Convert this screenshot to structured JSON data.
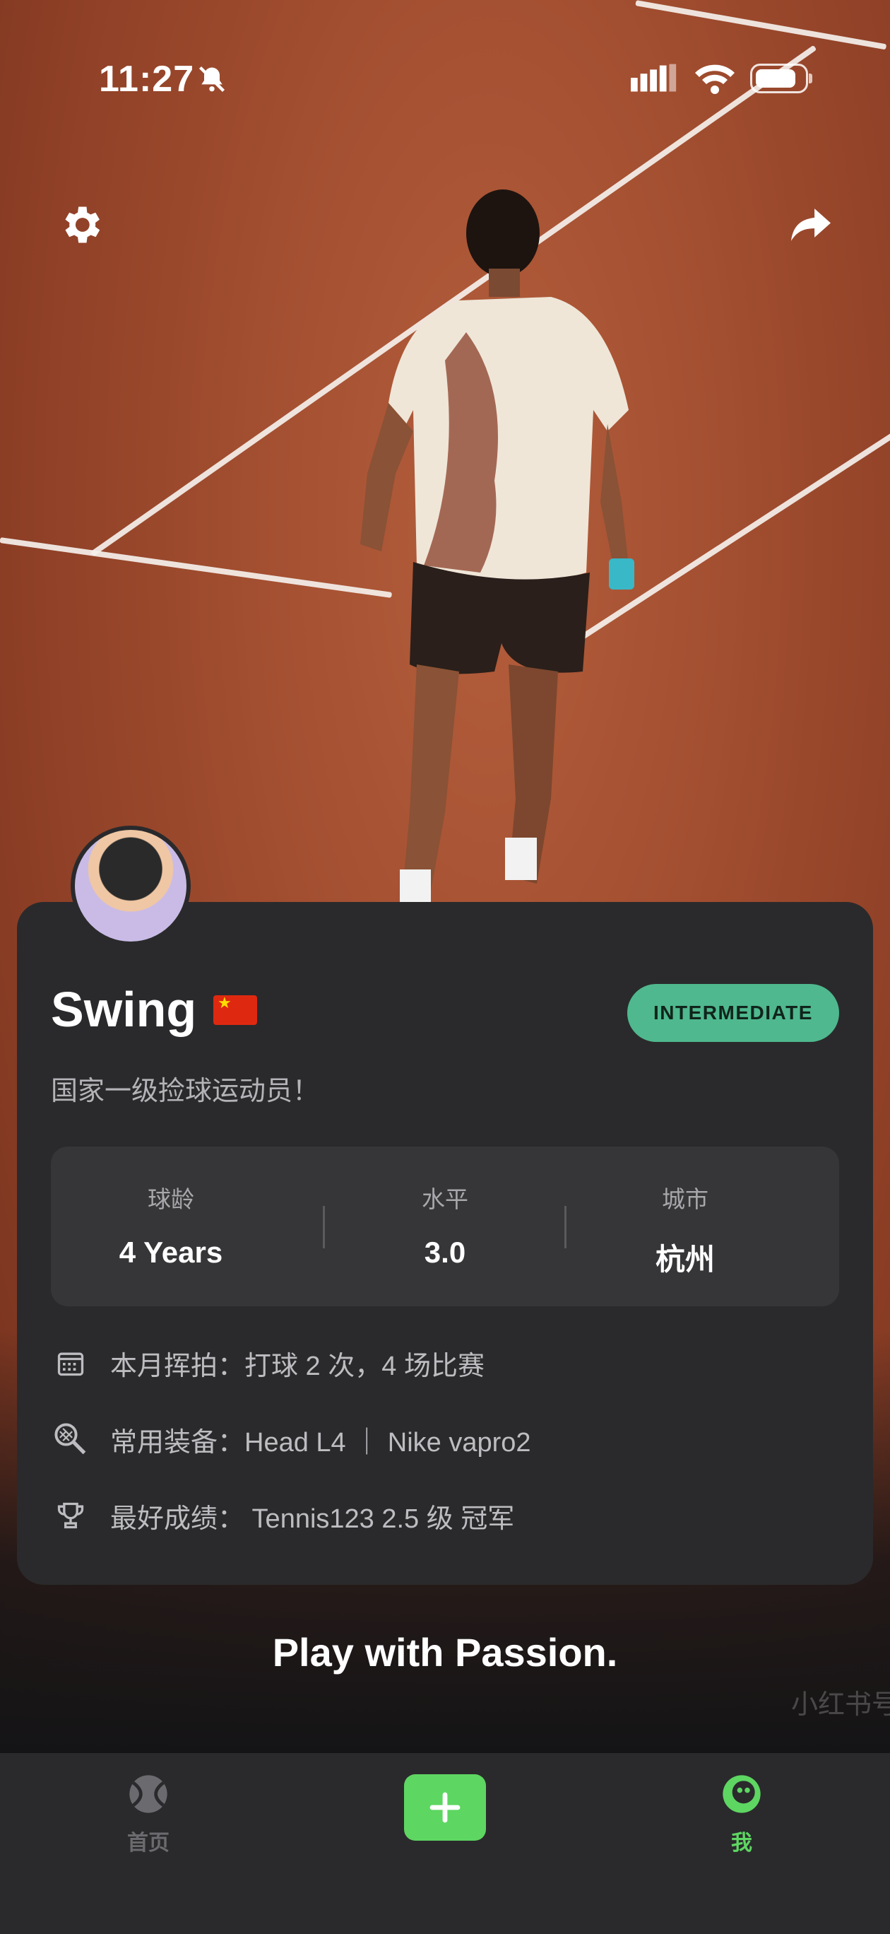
{
  "status_bar": {
    "time": "11:27"
  },
  "profile": {
    "name": "Swing",
    "flag": "🇨🇳",
    "level_badge": "INTERMEDIATE",
    "bio": "国家一级捡球运动员！"
  },
  "stats": [
    {
      "label": "球龄",
      "value": "4 Years"
    },
    {
      "label": "水平",
      "value": "3.0"
    },
    {
      "label": "城市",
      "value": "杭州"
    }
  ],
  "info": {
    "monthly": "本月挥拍：打球 2 次，4 场比赛",
    "gear": "常用装备：Head L4 ｜ Nike vapro2",
    "best": "最好成绩：  Tennis123 2.5 级 冠军"
  },
  "slogan": "Play with Passion.",
  "watermark": "小红书号",
  "tabbar": {
    "home_label": "首页",
    "me_label": "我",
    "inactive_color": "#6b6b6f",
    "active_color": "#5ed662"
  },
  "colors": {
    "badge": "#4fb88e",
    "card": "#2a2a2c",
    "accent": "#5ed662"
  }
}
